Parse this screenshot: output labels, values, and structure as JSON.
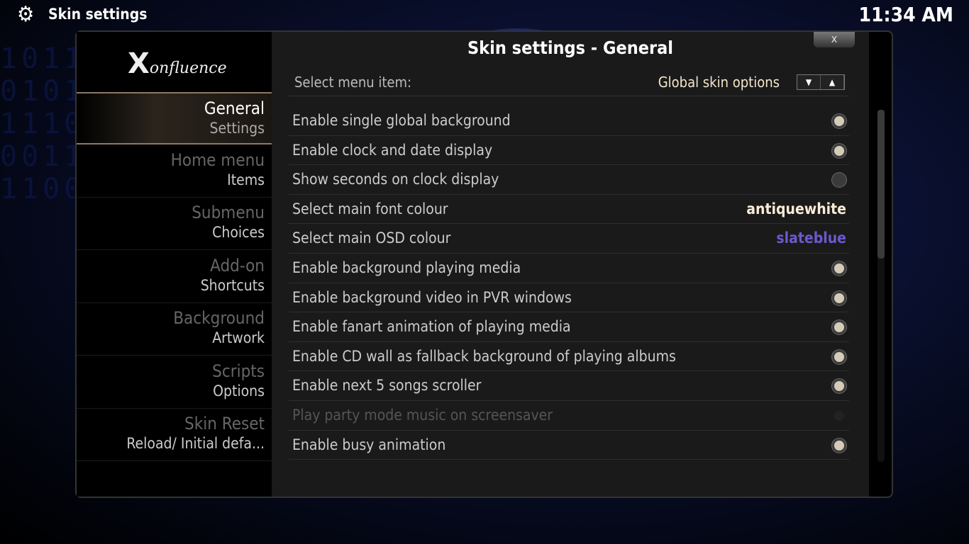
{
  "header": {
    "title": "Skin settings",
    "clock": "11:34 AM",
    "icon": "gear-icon"
  },
  "logo": {
    "text": "Xonfluence"
  },
  "sidebar": {
    "items": [
      {
        "line1": "General",
        "line2": "Settings",
        "active": true
      },
      {
        "line1": "Home menu",
        "line2": "Items"
      },
      {
        "line1": "Submenu",
        "line2": "Choices"
      },
      {
        "line1": "Add-on",
        "line2": "Shortcuts"
      },
      {
        "line1": "Background",
        "line2": "Artwork"
      },
      {
        "line1": "Scripts",
        "line2": "Options"
      },
      {
        "line1": "Skin Reset",
        "line2": "Reload/ Initial defa..."
      }
    ]
  },
  "dialog": {
    "title": "Skin settings - General",
    "close_label": "x",
    "select_menu": {
      "label": "Select menu item:",
      "value": "Global skin options"
    },
    "settings": [
      {
        "label": "Enable single global background",
        "type": "radio",
        "state": "on"
      },
      {
        "label": "Enable clock and date display",
        "type": "radio",
        "state": "on"
      },
      {
        "label": "Show seconds on clock display",
        "type": "radio",
        "state": "off"
      },
      {
        "label": "Select main font colour",
        "type": "value",
        "value": "antiquewhite",
        "color": "#faebd7"
      },
      {
        "label": "Select main OSD colour",
        "type": "value",
        "value": "slateblue",
        "color": "#6a5acd"
      },
      {
        "label": "Enable background playing media",
        "type": "radio",
        "state": "on"
      },
      {
        "label": "Enable background video in PVR windows",
        "type": "radio",
        "state": "on"
      },
      {
        "label": "Enable fanart animation of playing media",
        "type": "radio",
        "state": "on"
      },
      {
        "label": "Enable CD wall as fallback background of playing albums",
        "type": "radio",
        "state": "on"
      },
      {
        "label": "Enable next 5 songs scroller",
        "type": "radio",
        "state": "on"
      },
      {
        "label": "Play party mode music on screensaver",
        "type": "radio",
        "state": "disabled"
      },
      {
        "label": "Enable busy animation",
        "type": "radio",
        "state": "on"
      }
    ]
  },
  "colors": {
    "accent": "#f5e6cc",
    "selected_bar": "#8a7a60"
  }
}
